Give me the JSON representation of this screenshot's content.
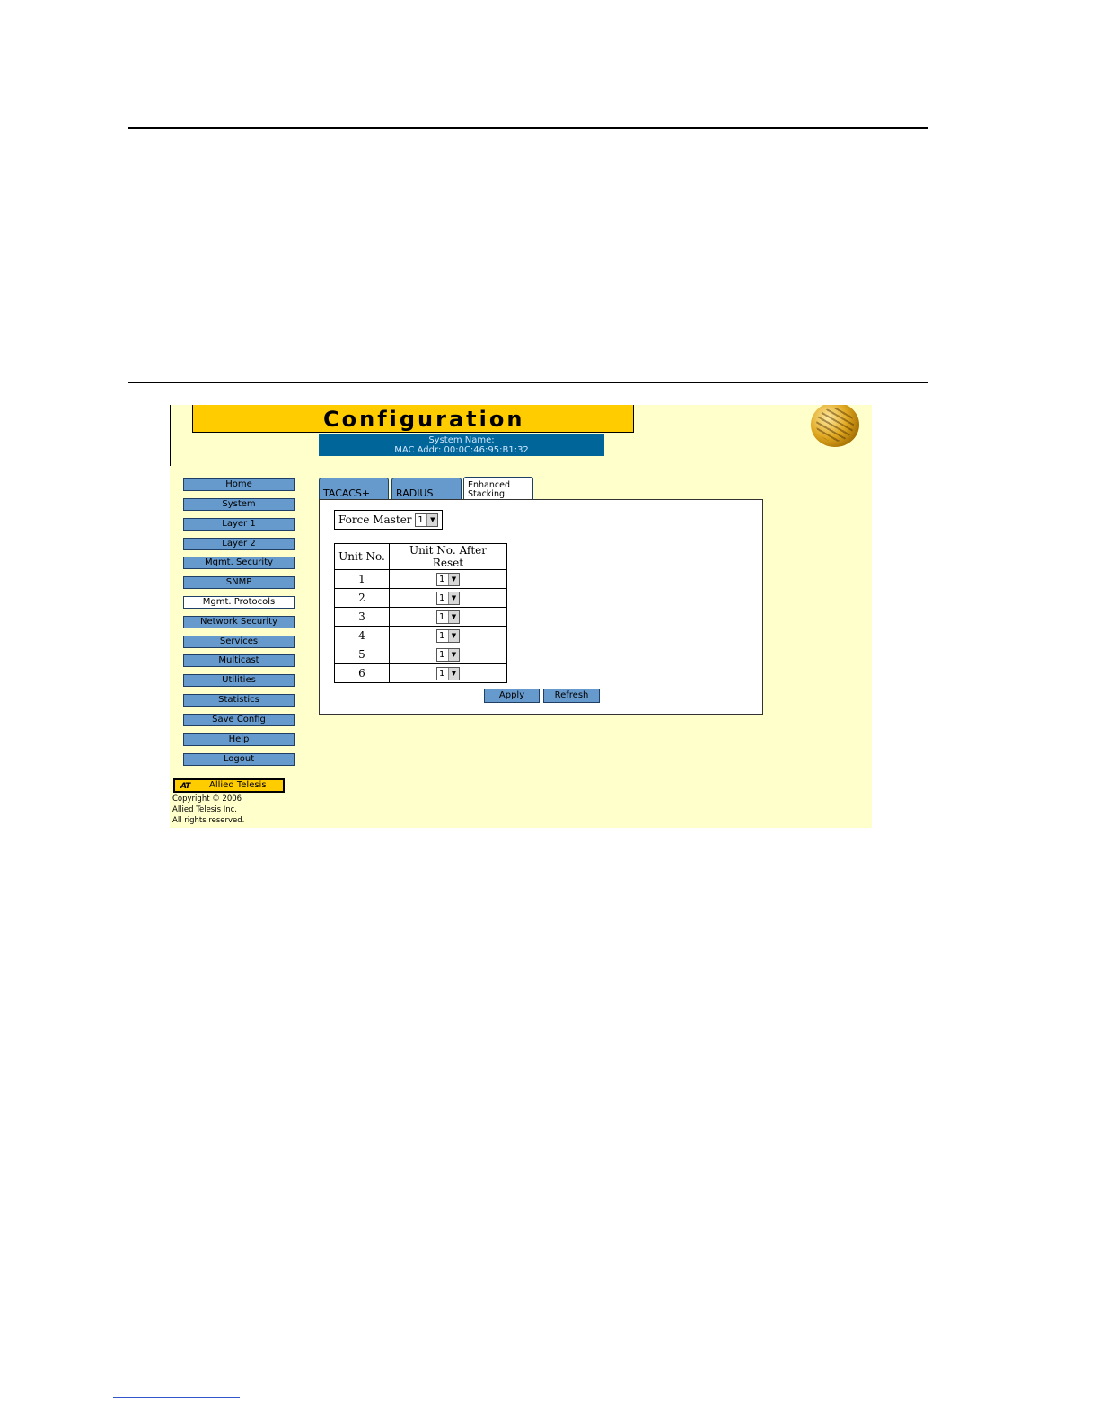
{
  "header": {
    "title": "Configuration",
    "system_name": "System Name:",
    "mac_addr": "MAC Addr: 00:0C:46:95:B1:32"
  },
  "sidebar": {
    "items": [
      {
        "label": "Home"
      },
      {
        "label": "System"
      },
      {
        "label": "Layer 1"
      },
      {
        "label": "Layer 2"
      },
      {
        "label": "Mgmt. Security"
      },
      {
        "label": "SNMP"
      },
      {
        "label": "Mgmt. Protocols",
        "active": true
      },
      {
        "label": "Network Security"
      },
      {
        "label": "Services"
      },
      {
        "label": "Multicast"
      },
      {
        "label": "Utilities"
      },
      {
        "label": "Statistics"
      },
      {
        "label": "Save Config"
      },
      {
        "label": "Help"
      },
      {
        "label": "Logout"
      }
    ],
    "logo_mark": "AT",
    "logo_name": "Allied Telesis",
    "copyright": [
      "Copyright © 2006",
      "Allied Telesis  Inc.",
      "All rights reserved."
    ]
  },
  "tabs": [
    {
      "label": "TACACS+"
    },
    {
      "label": "RADIUS"
    },
    {
      "label": "Enhanced Stacking",
      "line1": "Enhanced",
      "line2": "Stacking",
      "active": true
    }
  ],
  "panel": {
    "force_master_label": "Force Master",
    "force_master_value": "1",
    "table": {
      "headers": [
        "Unit No.",
        "Unit No. After Reset"
      ],
      "rows": [
        {
          "unit": "1",
          "after_reset": "1"
        },
        {
          "unit": "2",
          "after_reset": "1"
        },
        {
          "unit": "3",
          "after_reset": "1"
        },
        {
          "unit": "4",
          "after_reset": "1"
        },
        {
          "unit": "5",
          "after_reset": "1"
        },
        {
          "unit": "6",
          "after_reset": "1"
        }
      ]
    },
    "apply_label": "Apply",
    "refresh_label": "Refresh"
  },
  "colors": {
    "title_bar": "#ffcc00",
    "page_bg": "#ffffcc",
    "nav_button": "#6699cc",
    "info_bar": "#006699"
  },
  "icons": {
    "dropdown": "chevron-down-icon",
    "globe": "globe-icon"
  }
}
